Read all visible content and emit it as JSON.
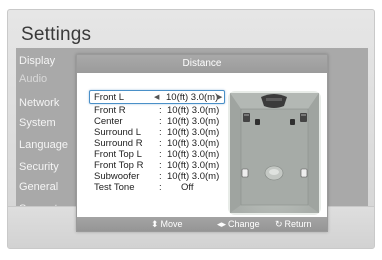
{
  "app": {
    "title": "Settings"
  },
  "sidebar": {
    "items": [
      {
        "label": "Display",
        "active": false
      },
      {
        "label": "Audio",
        "active": true
      },
      {
        "label": "Network",
        "active": false
      },
      {
        "label": "System",
        "active": false
      },
      {
        "label": "Language",
        "active": false
      },
      {
        "label": "Security",
        "active": false
      },
      {
        "label": "General",
        "active": false
      },
      {
        "label": "Support",
        "active": false
      }
    ]
  },
  "dialog": {
    "title": "Distance",
    "rows": [
      {
        "label": "Front L",
        "value": "10(ft) 3.0(m)"
      },
      {
        "label": "Front R",
        "value": "10(ft) 3.0(m)"
      },
      {
        "label": "Center",
        "value": "10(ft) 3.0(m)"
      },
      {
        "label": "Surround L",
        "value": "10(ft) 3.0(m)"
      },
      {
        "label": "Surround R",
        "value": "10(ft) 3.0(m)"
      },
      {
        "label": "Front Top L",
        "value": "10(ft) 3.0(m)"
      },
      {
        "label": "Front Top R",
        "value": "10(ft) 3.0(m)"
      },
      {
        "label": "Subwoofer",
        "value": "10(ft) 3.0(m)"
      },
      {
        "label": "Test Tone",
        "value": "Off"
      }
    ],
    "selected_index": 0,
    "footer": {
      "move_label": "Move",
      "change_label": "Change",
      "return_label": "Return"
    }
  },
  "colors": {
    "selection_border": "#4a90c8",
    "sidebar_bg": "#a9a9a9",
    "dialog_header": "#a9a9a9"
  },
  "icons": {
    "move": "up-down-arrow-icon",
    "change": "left-right-arrow-icon",
    "return": "return-arrow-icon"
  }
}
